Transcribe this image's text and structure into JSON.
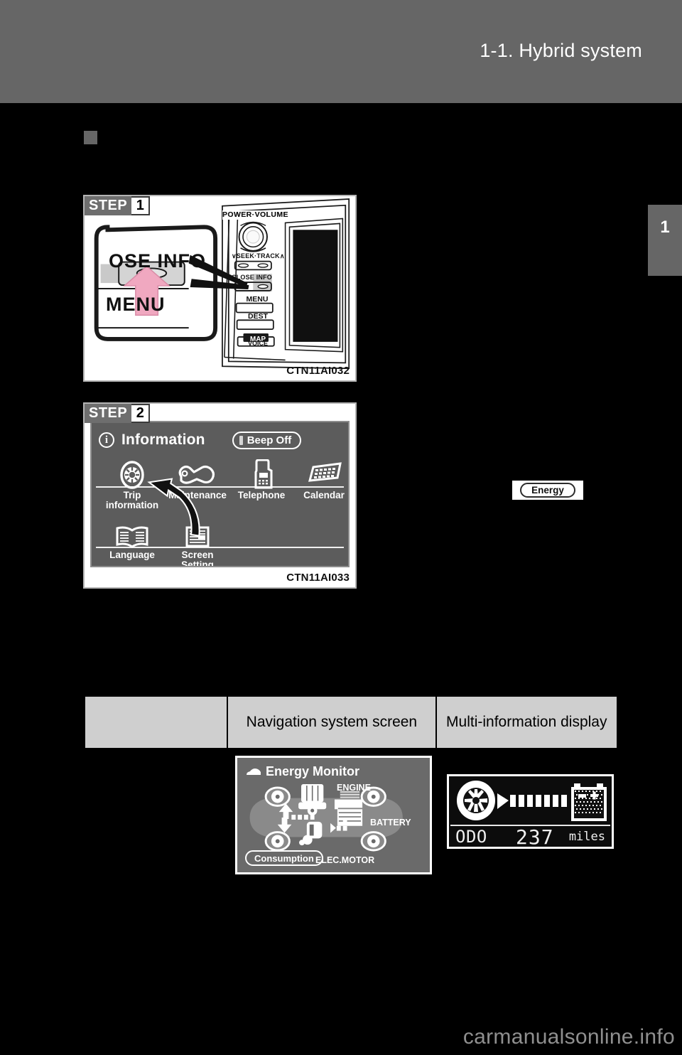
{
  "page": {
    "header_title": "1-1. Hybrid system",
    "chapter_tab": "1",
    "watermark": "carmanualsonline.info"
  },
  "figures": [
    {
      "step_word": "STEP",
      "step_num": "1",
      "code": "CTN11AI032",
      "callout_labels": [
        "OSE  INFO",
        "MENU"
      ],
      "panel_labels": {
        "power_volume": "POWER·VOLUME",
        "seek_track": "SEEK·TRACK",
        "close_info": "CLOSE  INFO",
        "menu": "MENU",
        "dest": "DEST",
        "map": "MAP",
        "voice": "VOICE",
        "seek_down": "∨",
        "seek_up": "∧"
      }
    },
    {
      "step_word": "STEP",
      "step_num": "2",
      "code": "CTN11AI033",
      "screen": {
        "title": "Information",
        "info_icon_letter": "i",
        "beep_label": "Beep Off",
        "items": [
          {
            "label": "Trip\ninformation",
            "icon": "tire-icon"
          },
          {
            "label": "Maintenance",
            "icon": "wrench-icon"
          },
          {
            "label": "Telephone",
            "icon": "phone-icon"
          },
          {
            "label": "Calendar",
            "icon": "calendar-icon"
          },
          {
            "label": "Language",
            "icon": "book-icon"
          },
          {
            "label": "Screen\nSetting",
            "icon": "screen-setting-icon"
          }
        ]
      }
    }
  ],
  "energy_button": {
    "label": "Energy"
  },
  "comparison_table": {
    "headers": [
      "",
      "Navigation system screen",
      "Multi-information display"
    ],
    "rows": [
      {
        "nav_screen": {
          "title": "Energy Monitor",
          "labels": {
            "engine": "ENGINE",
            "battery": "BATTERY",
            "motor": "ELEC.MOTOR"
          },
          "button": "Consumption"
        },
        "mid_screen": {
          "odo_label": "ODO",
          "odo_value": "237",
          "odo_unit": "miles",
          "battery_minus": "−",
          "battery_plus": "+"
        }
      }
    ]
  },
  "colors": {
    "page_bg": "#000000",
    "header_gray": "#666666",
    "table_header_gray": "#cfcfcf",
    "nav_screen_gray": "#5c5c5c",
    "energy_screen_gray": "#6a6a6a",
    "arrow_pink": "#f0a8c0",
    "mid_screen_bg": "#0c0c0c",
    "watermark_gray": "#8f8f8f"
  }
}
